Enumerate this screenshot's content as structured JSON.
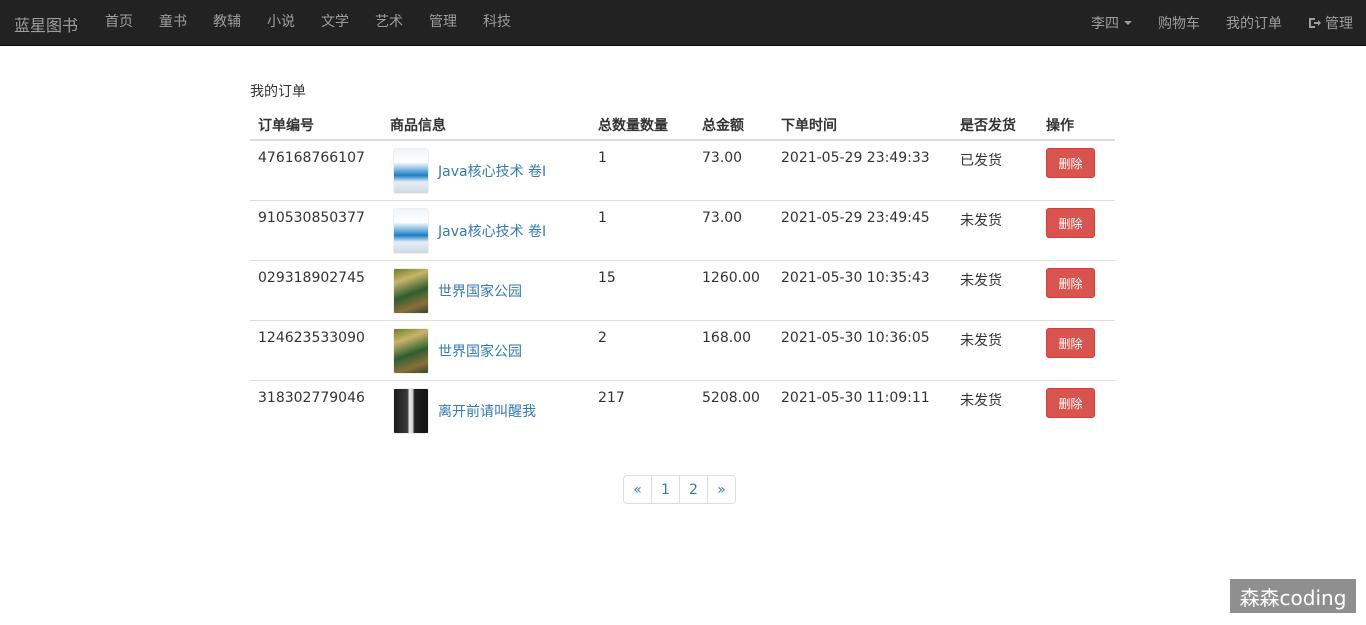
{
  "navbar": {
    "brand": "蓝星图书",
    "left_items": [
      "首页",
      "童书",
      "教辅",
      "小说",
      "文学",
      "艺术",
      "管理",
      "科技"
    ],
    "user_label": "李四",
    "cart_label": "购物车",
    "my_orders_label": "我的订单",
    "admin_label": "管理"
  },
  "page": {
    "heading": "我的订单"
  },
  "orders_table": {
    "headers": {
      "order_no": "订单编号",
      "product": "商品信息",
      "quantity": "总数量数量",
      "amount": "总金额",
      "time": "下单时间",
      "shipped": "是否发货",
      "action": "操作"
    },
    "rows": [
      {
        "order_no": "476168766107",
        "product": "Java核心技术 卷I",
        "quantity": "1",
        "amount": "73.00",
        "time": "2021-05-29 23:49:33",
        "shipped": "已发货",
        "action": "删除"
      },
      {
        "order_no": "910530850377",
        "product": "Java核心技术 卷I",
        "quantity": "1",
        "amount": "73.00",
        "time": "2021-05-29 23:49:45",
        "shipped": "未发货",
        "action": "删除"
      },
      {
        "order_no": "029318902745",
        "product": "世界国家公园",
        "quantity": "15",
        "amount": "1260.00",
        "time": "2021-05-30 10:35:43",
        "shipped": "未发货",
        "action": "删除"
      },
      {
        "order_no": "124623533090",
        "product": "世界国家公园",
        "quantity": "2",
        "amount": "168.00",
        "time": "2021-05-30 10:36:05",
        "shipped": "未发货",
        "action": "删除"
      },
      {
        "order_no": "318302779046",
        "product": "离开前请叫醒我",
        "quantity": "217",
        "amount": "5208.00",
        "time": "2021-05-30 11:09:11",
        "shipped": "未发货",
        "action": "删除"
      }
    ]
  },
  "pagination": {
    "prev": "«",
    "pages": [
      "1",
      "2"
    ],
    "next": "»"
  },
  "watermark": "森森coding",
  "colors": {
    "navbar_bg": "#222222",
    "nav_text": "#9d9d9d",
    "link": "#337ab7",
    "danger": "#d9534f"
  }
}
